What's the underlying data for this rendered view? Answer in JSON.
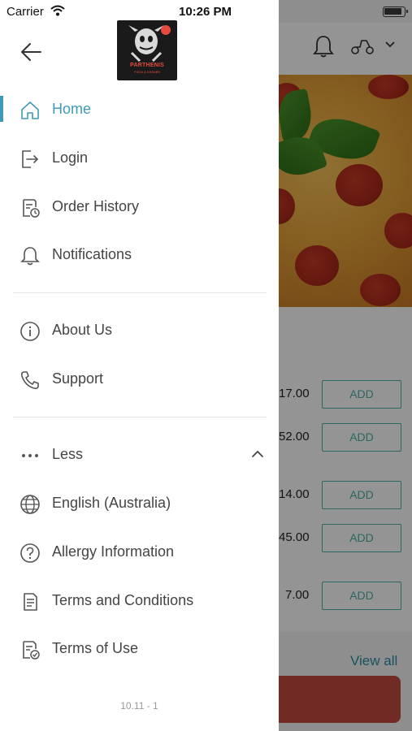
{
  "status_bar": {
    "carrier": "Carrier",
    "time": "10:26 PM"
  },
  "drawer": {
    "logo": {
      "name": "PARTHENIS",
      "sub": "PIZZA & KEBABS"
    },
    "menu_primary": [
      {
        "label": "Home",
        "icon": "home-icon",
        "active": true
      },
      {
        "label": "Login",
        "icon": "login-icon"
      },
      {
        "label": "Order History",
        "icon": "order-history-icon"
      },
      {
        "label": "Notifications",
        "icon": "bell-icon"
      }
    ],
    "menu_secondary": [
      {
        "label": "About Us",
        "icon": "info-icon"
      },
      {
        "label": "Support",
        "icon": "phone-icon"
      }
    ],
    "menu_more": [
      {
        "label": "Less",
        "icon": "more-dots-icon"
      },
      {
        "label": "English (Australia)",
        "icon": "globe-icon"
      },
      {
        "label": "Allergy Information",
        "icon": "help-circle-icon"
      },
      {
        "label": "Terms and Conditions",
        "icon": "document-icon"
      },
      {
        "label": "Terms of Use",
        "icon": "document-check-icon"
      }
    ],
    "version": "10.11 - 1"
  },
  "background_app": {
    "prices": [
      "17.00",
      "52.00",
      "14.00",
      "45.00",
      "7.00"
    ],
    "add_label": "ADD",
    "view_all": "View all"
  },
  "colors": {
    "accent": "#3f9bb3",
    "add_border": "#4bb0a4",
    "cta": "#c44b3f"
  }
}
